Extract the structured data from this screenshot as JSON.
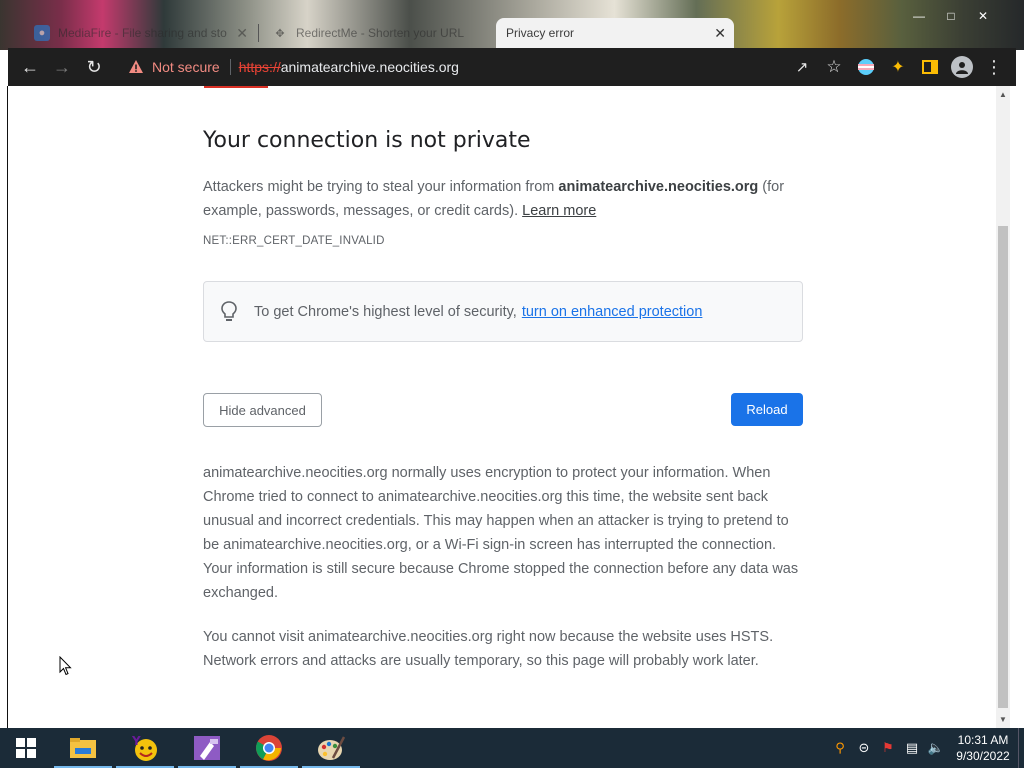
{
  "tabs": [
    {
      "title": "MediaFire - File sharing and sto",
      "favicon": "mediafire-icon",
      "active": false
    },
    {
      "title": "RedirectMe - Shorten your URL",
      "favicon": "redirectme-icon",
      "active": false
    },
    {
      "title": "Privacy error",
      "favicon": "",
      "active": true
    }
  ],
  "toolbar": {
    "security_label": "Not secure",
    "url_scheme": "https://",
    "url_host": "animatearchive.neocities.org"
  },
  "page": {
    "heading": "Your connection is not private",
    "intro_prefix": "Attackers might be trying to steal your information from ",
    "intro_host": "animatearchive.neocities.org",
    "intro_suffix": " (for example, passwords, messages, or credit cards).",
    "learn_more": "Learn more",
    "error_code": "NET::ERR_CERT_DATE_INVALID",
    "enhanced_text": "To get Chrome's highest level of security,",
    "enhanced_link": "turn on enhanced protection",
    "hide_advanced_label": "Hide advanced",
    "reload_label": "Reload",
    "details_1": "animatearchive.neocities.org normally uses encryption to protect your information. When Chrome tried to connect to animatearchive.neocities.org this time, the website sent back unusual and incorrect credentials. This may happen when an attacker is trying to pretend to be animatearchive.neocities.org, or a Wi-Fi sign-in screen has interrupted the connection. Your information is still secure because Chrome stopped the connection before any data was exchanged.",
    "details_2": "You cannot visit animatearchive.neocities.org right now because the website uses HSTS. Network errors and attacks are usually temporary, so this page will probably work later."
  },
  "taskbar": {
    "apps": [
      "file-explorer-icon",
      "yahoo-messenger-icon",
      "visual-studio-icon",
      "chrome-icon",
      "paint-icon"
    ],
    "time": "10:31 AM",
    "date": "9/30/2022"
  },
  "colors": {
    "accent": "#1a73e8",
    "danger": "#d93025",
    "toolbar_bg": "#1f1f1f",
    "taskbar_bg": "#1b2b38"
  }
}
